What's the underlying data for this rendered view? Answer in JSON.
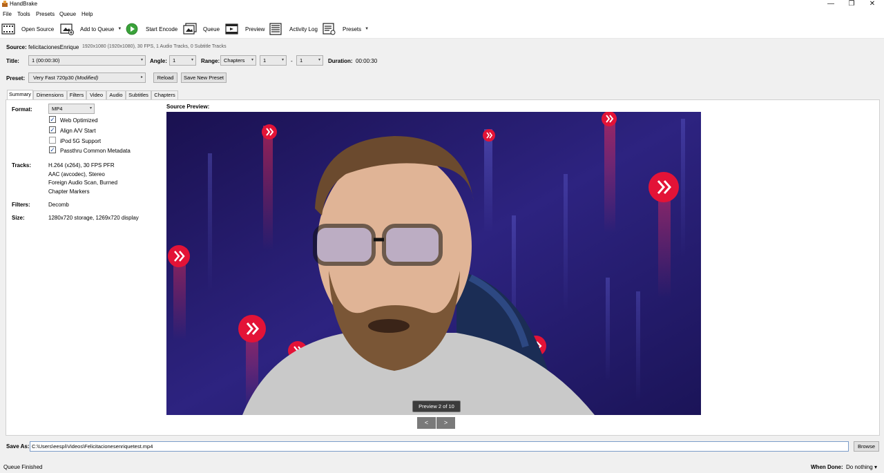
{
  "window": {
    "title": "HandBrake",
    "controls": [
      "—",
      "❐",
      "✕"
    ]
  },
  "menu": [
    "File",
    "Tools",
    "Presets",
    "Queue",
    "Help"
  ],
  "toolbar": {
    "open_source": "Open Source",
    "add_to_queue": "Add to Queue",
    "start_encode": "Start Encode",
    "queue": "Queue",
    "preview": "Preview",
    "activity_log": "Activity Log",
    "presets": "Presets",
    "arrow": "▼"
  },
  "source": {
    "label": "Source:",
    "name": "felicitacionesEnrique",
    "info": "1920x1080 (1920x1080), 30 FPS, 1 Audio Tracks, 0 Subtitle Tracks"
  },
  "title_row": {
    "title_label": "Title:",
    "title_value": "1 (00:00:30)",
    "angle_label": "Angle:",
    "angle_value": "1",
    "range_label": "Range:",
    "range_value": "Chapters",
    "range_start": "1",
    "range_sep": "-",
    "range_end": "1",
    "duration_label": "Duration:",
    "duration_value": "00:00:30"
  },
  "preset_row": {
    "label": "Preset:",
    "value": "Very Fast 720p30",
    "modified": "(Modified)",
    "reload": "Reload",
    "save_new": "Save New Preset"
  },
  "tabs": [
    "Summary",
    "Dimensions",
    "Filters",
    "Video",
    "Audio",
    "Subtitles",
    "Chapters"
  ],
  "summary": {
    "format_label": "Format:",
    "format_value": "MP4",
    "options": [
      {
        "label": "Web Optimized",
        "checked": true
      },
      {
        "label": "Align A/V Start",
        "checked": true
      },
      {
        "label": "iPod 5G Support",
        "checked": false
      },
      {
        "label": "Passthru Common Metadata",
        "checked": true
      }
    ],
    "tracks_label": "Tracks:",
    "tracks": [
      "H.264 (x264), 30 FPS PFR",
      "AAC (avcodec), Stereo",
      "Foreign Audio Scan, Burned",
      "Chapter Markers"
    ],
    "filters_label": "Filters:",
    "filters_value": "Decomb",
    "size_label": "Size:",
    "size_value": "1280x720 storage, 1269x720 display",
    "check_mark": "✓"
  },
  "preview": {
    "label": "Source Preview:",
    "badge": "Preview 2 of 10",
    "prev": "<",
    "next": ">"
  },
  "save_as": {
    "label": "Save As:",
    "path": "C:\\Users\\eespi\\Videos\\Felicitacionesenriquetest.mp4",
    "browse": "Browse"
  },
  "status": {
    "left": "Queue Finished",
    "when_done_label": "When Done:",
    "when_done_value": "Do nothing",
    "arrow": "▾"
  },
  "colors": {
    "start_encode_green": "#3aa23a",
    "preview_bg": "#2a1e6e",
    "hive_red": "#e31337"
  }
}
